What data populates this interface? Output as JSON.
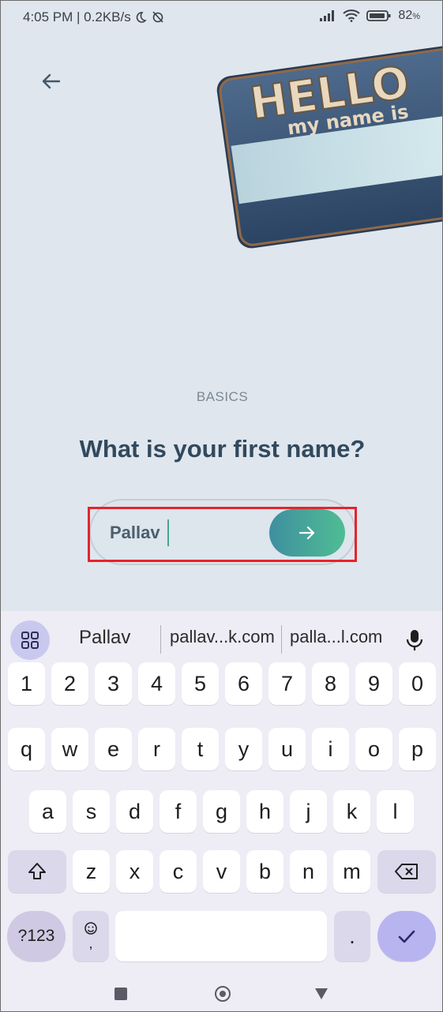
{
  "status_bar": {
    "time": "4:05 PM",
    "speed": "| 0.2KB/s",
    "battery": "82"
  },
  "screen": {
    "section_label": "BASICS",
    "question": "What is your first name?",
    "input_value": "Pallav",
    "badge": {
      "line1": "HELLO",
      "line2": "my name is"
    }
  },
  "keyboard": {
    "suggestions": [
      "Pallav",
      "pallav...k.com",
      "palla...l.com"
    ],
    "row_numbers": [
      "1",
      "2",
      "3",
      "4",
      "5",
      "6",
      "7",
      "8",
      "9",
      "0"
    ],
    "row1": [
      "q",
      "w",
      "e",
      "r",
      "t",
      "y",
      "u",
      "i",
      "o",
      "p"
    ],
    "row2": [
      "a",
      "s",
      "d",
      "f",
      "g",
      "h",
      "j",
      "k",
      "l"
    ],
    "row3": [
      "z",
      "x",
      "c",
      "v",
      "b",
      "n",
      "m"
    ],
    "sym_label": "?123",
    "emoji_comma": ",",
    "period": "."
  },
  "colors": {
    "background": "#dfe6ee",
    "question": "#32495d",
    "accent_start": "#3f8f9f",
    "accent_end": "#4fbd94",
    "highlight": "#e5242b"
  }
}
